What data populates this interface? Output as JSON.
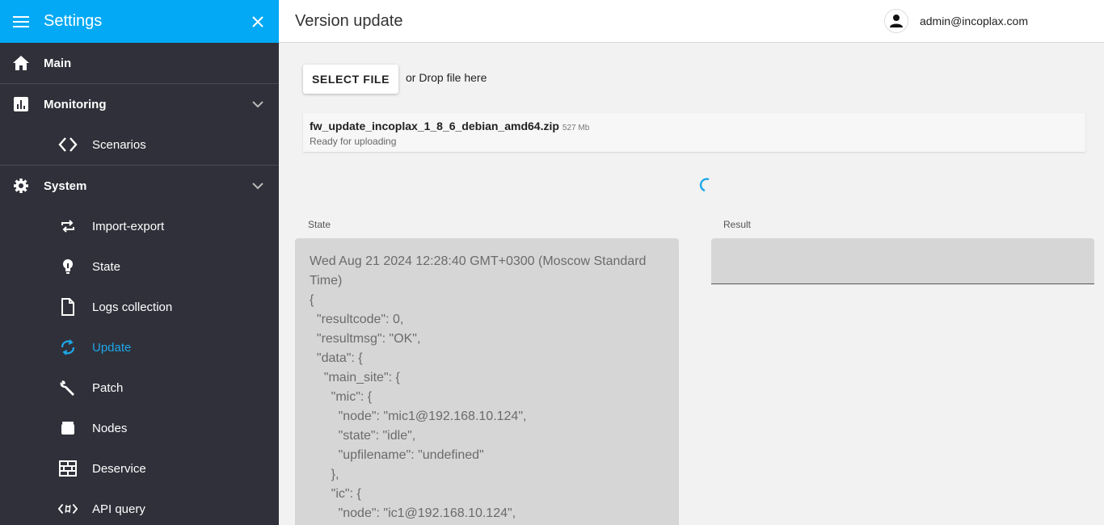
{
  "sidebar": {
    "title": "Settings",
    "items": [
      {
        "label": "Main",
        "icon": "home-icon"
      },
      {
        "label": "Monitoring",
        "icon": "bar-chart-icon"
      },
      {
        "label": "Scenarios",
        "icon": "code-icon"
      },
      {
        "label": "System",
        "icon": "gear-icon"
      },
      {
        "label": "Import-export",
        "icon": "repeat-icon"
      },
      {
        "label": "State",
        "icon": "lightbulb-icon"
      },
      {
        "label": "Logs collection",
        "icon": "file-icon"
      },
      {
        "label": "Update",
        "icon": "sync-icon"
      },
      {
        "label": "Patch",
        "icon": "wrench-icon"
      },
      {
        "label": "Nodes",
        "icon": "box-icon"
      },
      {
        "label": "Deservice",
        "icon": "brick-wall-icon"
      },
      {
        "label": "API query",
        "icon": "code-hash-icon"
      }
    ],
    "active_item": "Update",
    "colors": {
      "header": "#03a9f4",
      "background": "#2f3039",
      "active": "#1ea7e8"
    }
  },
  "header": {
    "page_title": "Version update",
    "user": "admin@incoplax.com"
  },
  "upload": {
    "select_label": "SELECT FILE",
    "drop_text": "or Drop file here",
    "file_name": "fw_update_incoplax_1_8_6_debian_amd64.zip",
    "file_size": "527 Mb",
    "file_status": "Ready for uploading"
  },
  "panels": {
    "state_label": "State",
    "result_label": "Result",
    "state_text": "Wed Aug 21 2024 12:28:40 GMT+0300 (Moscow Standard Time)\n{\n  \"resultcode\": 0,\n  \"resultmsg\": \"OK\",\n  \"data\": {\n    \"main_site\": {\n      \"mic\": {\n        \"node\": \"mic1@192.168.10.124\",\n        \"state\": \"idle\",\n        \"upfilename\": \"undefined\"\n      },\n      \"ic\": {\n        \"node\": \"ic1@192.168.10.124\",",
    "result_text": ""
  }
}
